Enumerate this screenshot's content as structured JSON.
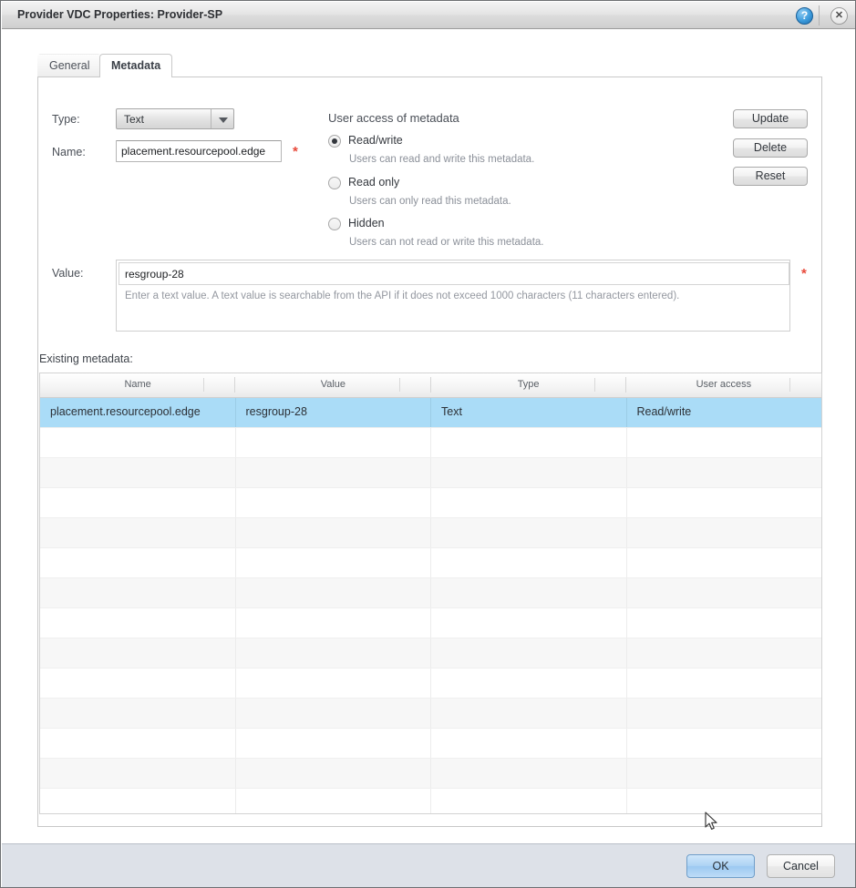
{
  "window": {
    "title": "Provider VDC Properties: Provider-SP",
    "help_icon": "?",
    "close_icon": "✕"
  },
  "tabs": [
    {
      "label": "General",
      "active": false
    },
    {
      "label": "Metadata",
      "active": true
    }
  ],
  "form": {
    "type_label": "Type:",
    "type_value": "Text",
    "name_label": "Name:",
    "name_value": "placement.resourcepool.edge",
    "name_placeholder": "",
    "required_marker": "*",
    "value_label": "Value:",
    "value_value": "resgroup-28",
    "value_placeholder": "",
    "value_hint": "Enter a text value. A text value is searchable from the API if it does not exceed 1000 characters (11 characters entered)."
  },
  "access": {
    "title": "User access of metadata",
    "options": [
      {
        "label": "Read/write",
        "hint": "Users can read and write this metadata.",
        "selected": true
      },
      {
        "label": "Read only",
        "hint": "Users can only read this metadata.",
        "selected": false
      },
      {
        "label": "Hidden",
        "hint": "Users can not read or write this metadata.",
        "selected": false
      }
    ]
  },
  "actions": {
    "update": "Update",
    "delete": "Delete",
    "reset": "Reset"
  },
  "existing": {
    "label": "Existing metadata:",
    "columns": [
      "Name",
      "Value",
      "Type",
      "User access"
    ],
    "rows": [
      {
        "name": "placement.resourcepool.edge",
        "value": "resgroup-28",
        "type": "Text",
        "access": "Read/write",
        "selected": true
      }
    ],
    "empty_row_count": 14
  },
  "footer": {
    "ok": "OK",
    "cancel": "Cancel"
  },
  "colors": {
    "selection": "#aadcf7",
    "required": "#e8493a",
    "footer": "#dde1e8"
  }
}
